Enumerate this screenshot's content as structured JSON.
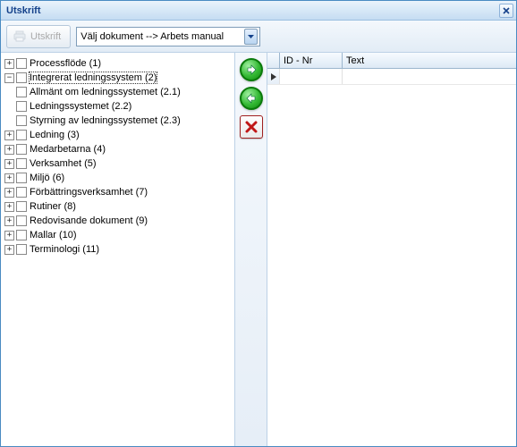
{
  "window": {
    "title": "Utskrift"
  },
  "toolbar": {
    "print_label": "Utskrift",
    "dropdown_value": "Välj dokument --> Arbets manual"
  },
  "tree": {
    "root": [
      {
        "label": "Processflöde (1)",
        "expanded": false,
        "hasChildren": true
      },
      {
        "label": "Integrerat ledningssystem (2)",
        "expanded": true,
        "hasChildren": true,
        "selected": true,
        "children": [
          {
            "label": "Allmänt om ledningssystemet (2.1)"
          },
          {
            "label": "Ledningssystemet (2.2)"
          },
          {
            "label": "Styrning av ledningssystemet (2.3)"
          }
        ]
      },
      {
        "label": "Ledning (3)",
        "expanded": false,
        "hasChildren": true
      },
      {
        "label": "Medarbetarna (4)",
        "expanded": false,
        "hasChildren": true
      },
      {
        "label": "Verksamhet (5)",
        "expanded": false,
        "hasChildren": true
      },
      {
        "label": "Miljö (6)",
        "expanded": false,
        "hasChildren": true
      },
      {
        "label": "Förbättringsverksamhet (7)",
        "expanded": false,
        "hasChildren": true
      },
      {
        "label": "Rutiner (8)",
        "expanded": false,
        "hasChildren": true
      },
      {
        "label": "Redovisande dokument (9)",
        "expanded": false,
        "hasChildren": true
      },
      {
        "label": "Mallar (10)",
        "expanded": false,
        "hasChildren": true
      },
      {
        "label": "Terminologi (11)",
        "expanded": false,
        "hasChildren": true
      }
    ]
  },
  "grid": {
    "columns": {
      "id": "ID - Nr",
      "text": "Text"
    },
    "rows": [
      {
        "id": "",
        "text": ""
      }
    ]
  },
  "icons": {
    "forward": "arrow-right",
    "back": "arrow-left",
    "delete": "x"
  }
}
